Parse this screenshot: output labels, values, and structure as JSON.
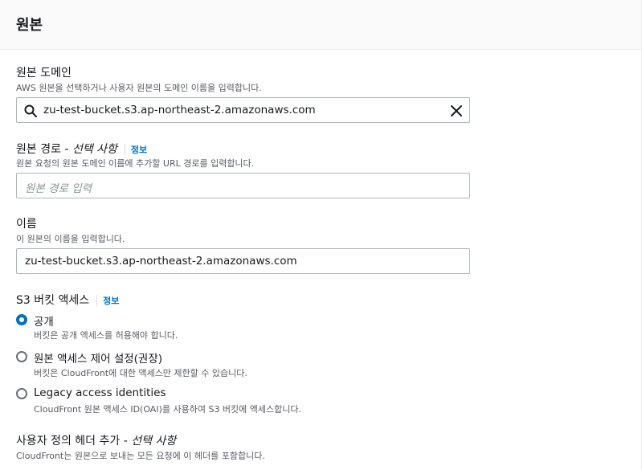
{
  "header": {
    "title": "원본"
  },
  "origin_domain": {
    "label": "원본 도메인",
    "description": "AWS 원본을 선택하거나 사용자 원본의 도메인 이름을 입력합니다.",
    "value": "zu-test-bucket.s3.ap-northeast-2.amazonaws.com",
    "icons": {
      "search": "search-icon",
      "clear": "close-icon"
    }
  },
  "origin_path": {
    "label": "원본 경로 - ",
    "optional": "선택 사항",
    "info": "정보",
    "description": "원본 요청의 원본 도메인 이름에 추가할 URL 경로를 입력합니다.",
    "placeholder": "원본 경로 입력"
  },
  "name": {
    "label": "이름",
    "description": "이 원본의 이름을 입력합니다.",
    "value": "zu-test-bucket.s3.ap-northeast-2.amazonaws.com"
  },
  "s3_access": {
    "label": "S3 버킷 액세스",
    "info": "정보",
    "options": [
      {
        "label": "공개",
        "description": "버킷은 공개 액세스를 허용해야 합니다.",
        "selected": true
      },
      {
        "label": "원본 액세스 제어 설정(권장)",
        "description": "버킷은 CloudFront에 대한 액세스만 제한할 수 있습니다.",
        "selected": false
      },
      {
        "label": "Legacy access identities",
        "description": "CloudFront 원본 액세스 ID(OAI)를 사용하여 S3 버킷에 액세스합니다.",
        "selected": false
      }
    ]
  },
  "custom_headers": {
    "label": "사용자 정의 헤더 추가 - ",
    "optional": "선택 사항",
    "description": "CloudFront는 원본으로 보내는 모든 요청에 이 헤더를 포함합니다."
  },
  "colors": {
    "accent": "#0073bb",
    "text": "#16191f",
    "muted": "#545b64",
    "border": "#aab7b8",
    "header_bg": "#fafafa"
  }
}
